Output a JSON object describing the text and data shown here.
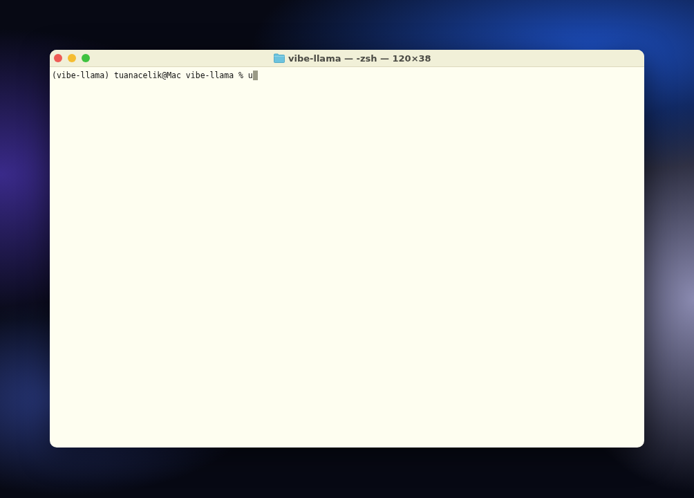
{
  "window": {
    "title": "vibe-llama — -zsh — 120×38"
  },
  "terminal": {
    "lines": [
      {
        "text": "(vibe-llama) tuanacelik@Mac vibe-llama % u",
        "cursor": true
      }
    ]
  }
}
